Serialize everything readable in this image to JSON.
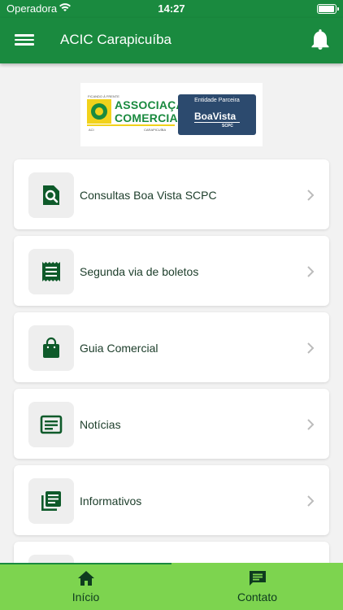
{
  "status_bar": {
    "carrier": "Operadora",
    "time": "14:27"
  },
  "app_bar": {
    "title": "ACIC Carapicuíba"
  },
  "banner": {
    "left_logo": {
      "line1": "ASSOCIAÇÃO",
      "line2": "COMERCIAL",
      "city": "CARAPICUÍBA",
      "tagline": "FICANDO À FRENTE",
      "abbr": "ACI"
    },
    "right_logo": {
      "header": "Entidade Parceira",
      "brand": "BoaVista",
      "sub": "SCPC"
    }
  },
  "menu_items": [
    {
      "label": "Consultas Boa Vista SCPC",
      "icon": "search-document-icon"
    },
    {
      "label": "Segunda via de boletos",
      "icon": "receipt-icon"
    },
    {
      "label": "Guia Comercial",
      "icon": "shopping-bag-icon"
    },
    {
      "label": "Notícias",
      "icon": "news-icon"
    },
    {
      "label": "Informativos",
      "icon": "library-books-icon"
    }
  ],
  "bottom_nav": {
    "tabs": [
      {
        "label": "Início",
        "icon": "home-icon"
      },
      {
        "label": "Contato",
        "icon": "chat-icon"
      }
    ],
    "selected_index": 0
  },
  "colors": {
    "primary": "#1a8a3f",
    "bottom_nav_bg": "#7dd44f",
    "icon_dark_green": "#0e5a2a",
    "label_text": "#1c3d2a",
    "card_bg": "#ffffff",
    "page_bg": "#f2f2f2"
  }
}
